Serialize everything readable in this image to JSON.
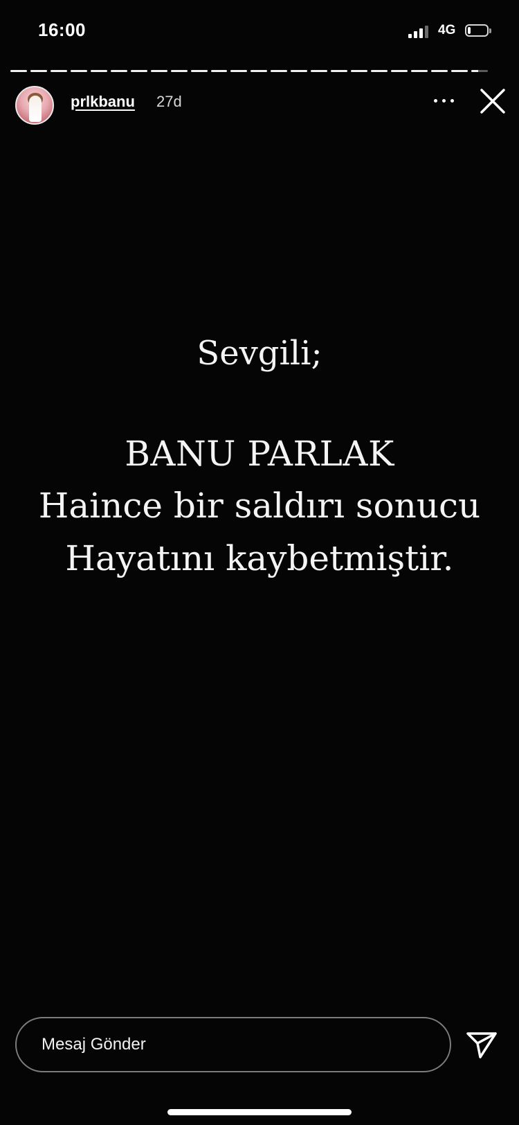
{
  "status_bar": {
    "time": "16:00",
    "network": "4G",
    "signal_bars": 4,
    "signal_bars_lit": 3,
    "battery_level": 0.15,
    "icons": [
      "signal-icon",
      "battery-icon"
    ]
  },
  "story_progress": {
    "segment_count": 24,
    "current_segment": 24,
    "current_progress": 0.4
  },
  "header": {
    "username": "prlkbanu",
    "post_age": "27d",
    "icons": [
      "avatar",
      "more-icon",
      "close-icon"
    ]
  },
  "story": {
    "greeting": "Sevgili;",
    "name": "BANU PARLAK",
    "line_two": "Haince bir saldırı sonucu",
    "line_three": "Hayatını kaybetmiştir."
  },
  "reply": {
    "placeholder": "Mesaj Gönder",
    "value": "",
    "send_icon": "send-icon"
  },
  "colors": {
    "background": "#050505",
    "text": "#f4f4f4",
    "reply_border": "#7d7d7d"
  }
}
